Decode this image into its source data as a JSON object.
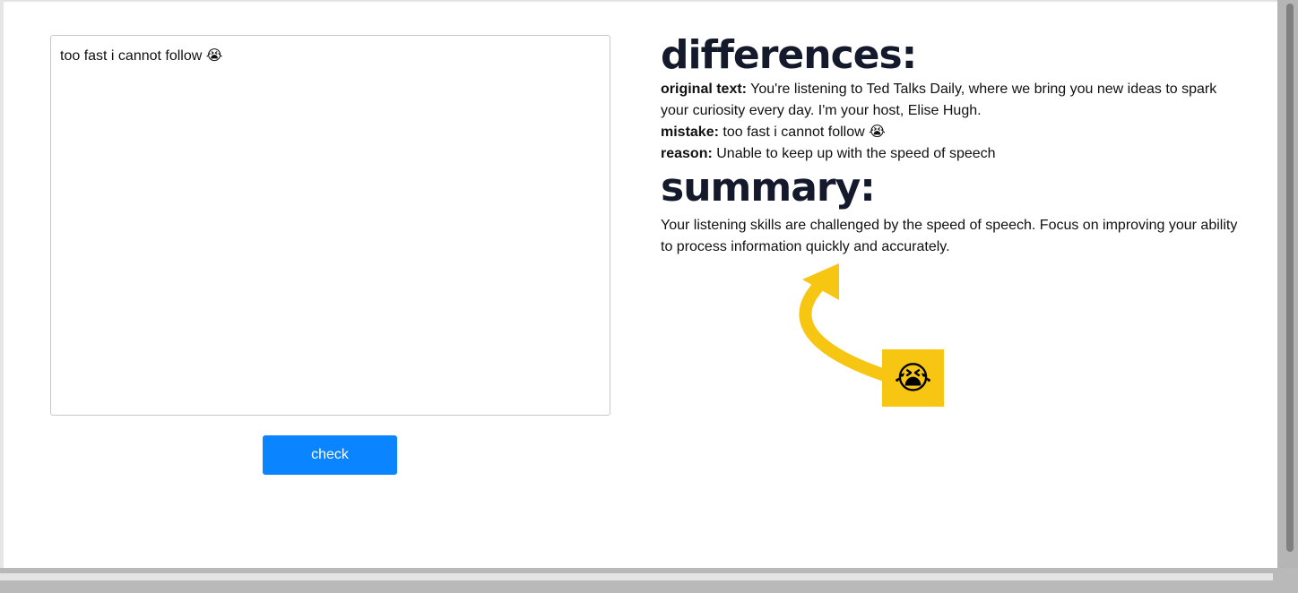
{
  "input": {
    "value": "too fast i cannot follow 😭"
  },
  "check_button": {
    "label": "check"
  },
  "differences": {
    "heading": "differences:",
    "original_label": "original text:",
    "original_value": "You're listening to Ted Talks Daily, where we bring you new ideas to spark your curiosity every day. I'm your host, Elise Hugh.",
    "mistake_label": "mistake:",
    "mistake_value": "too fast i cannot follow 😭",
    "reason_label": "reason:",
    "reason_value": "Unable to keep up with the speed of speech"
  },
  "summary": {
    "heading": "summary:",
    "text": "Your listening skills are challenged by the speed of speech. Focus on improving your ability to process information quickly and accurately."
  },
  "annotation": {
    "emoji": "😭",
    "arrow_color": "#f6c613"
  },
  "colors": {
    "button_blue": "#0a84ff",
    "heading_dark": "#141a2b"
  }
}
